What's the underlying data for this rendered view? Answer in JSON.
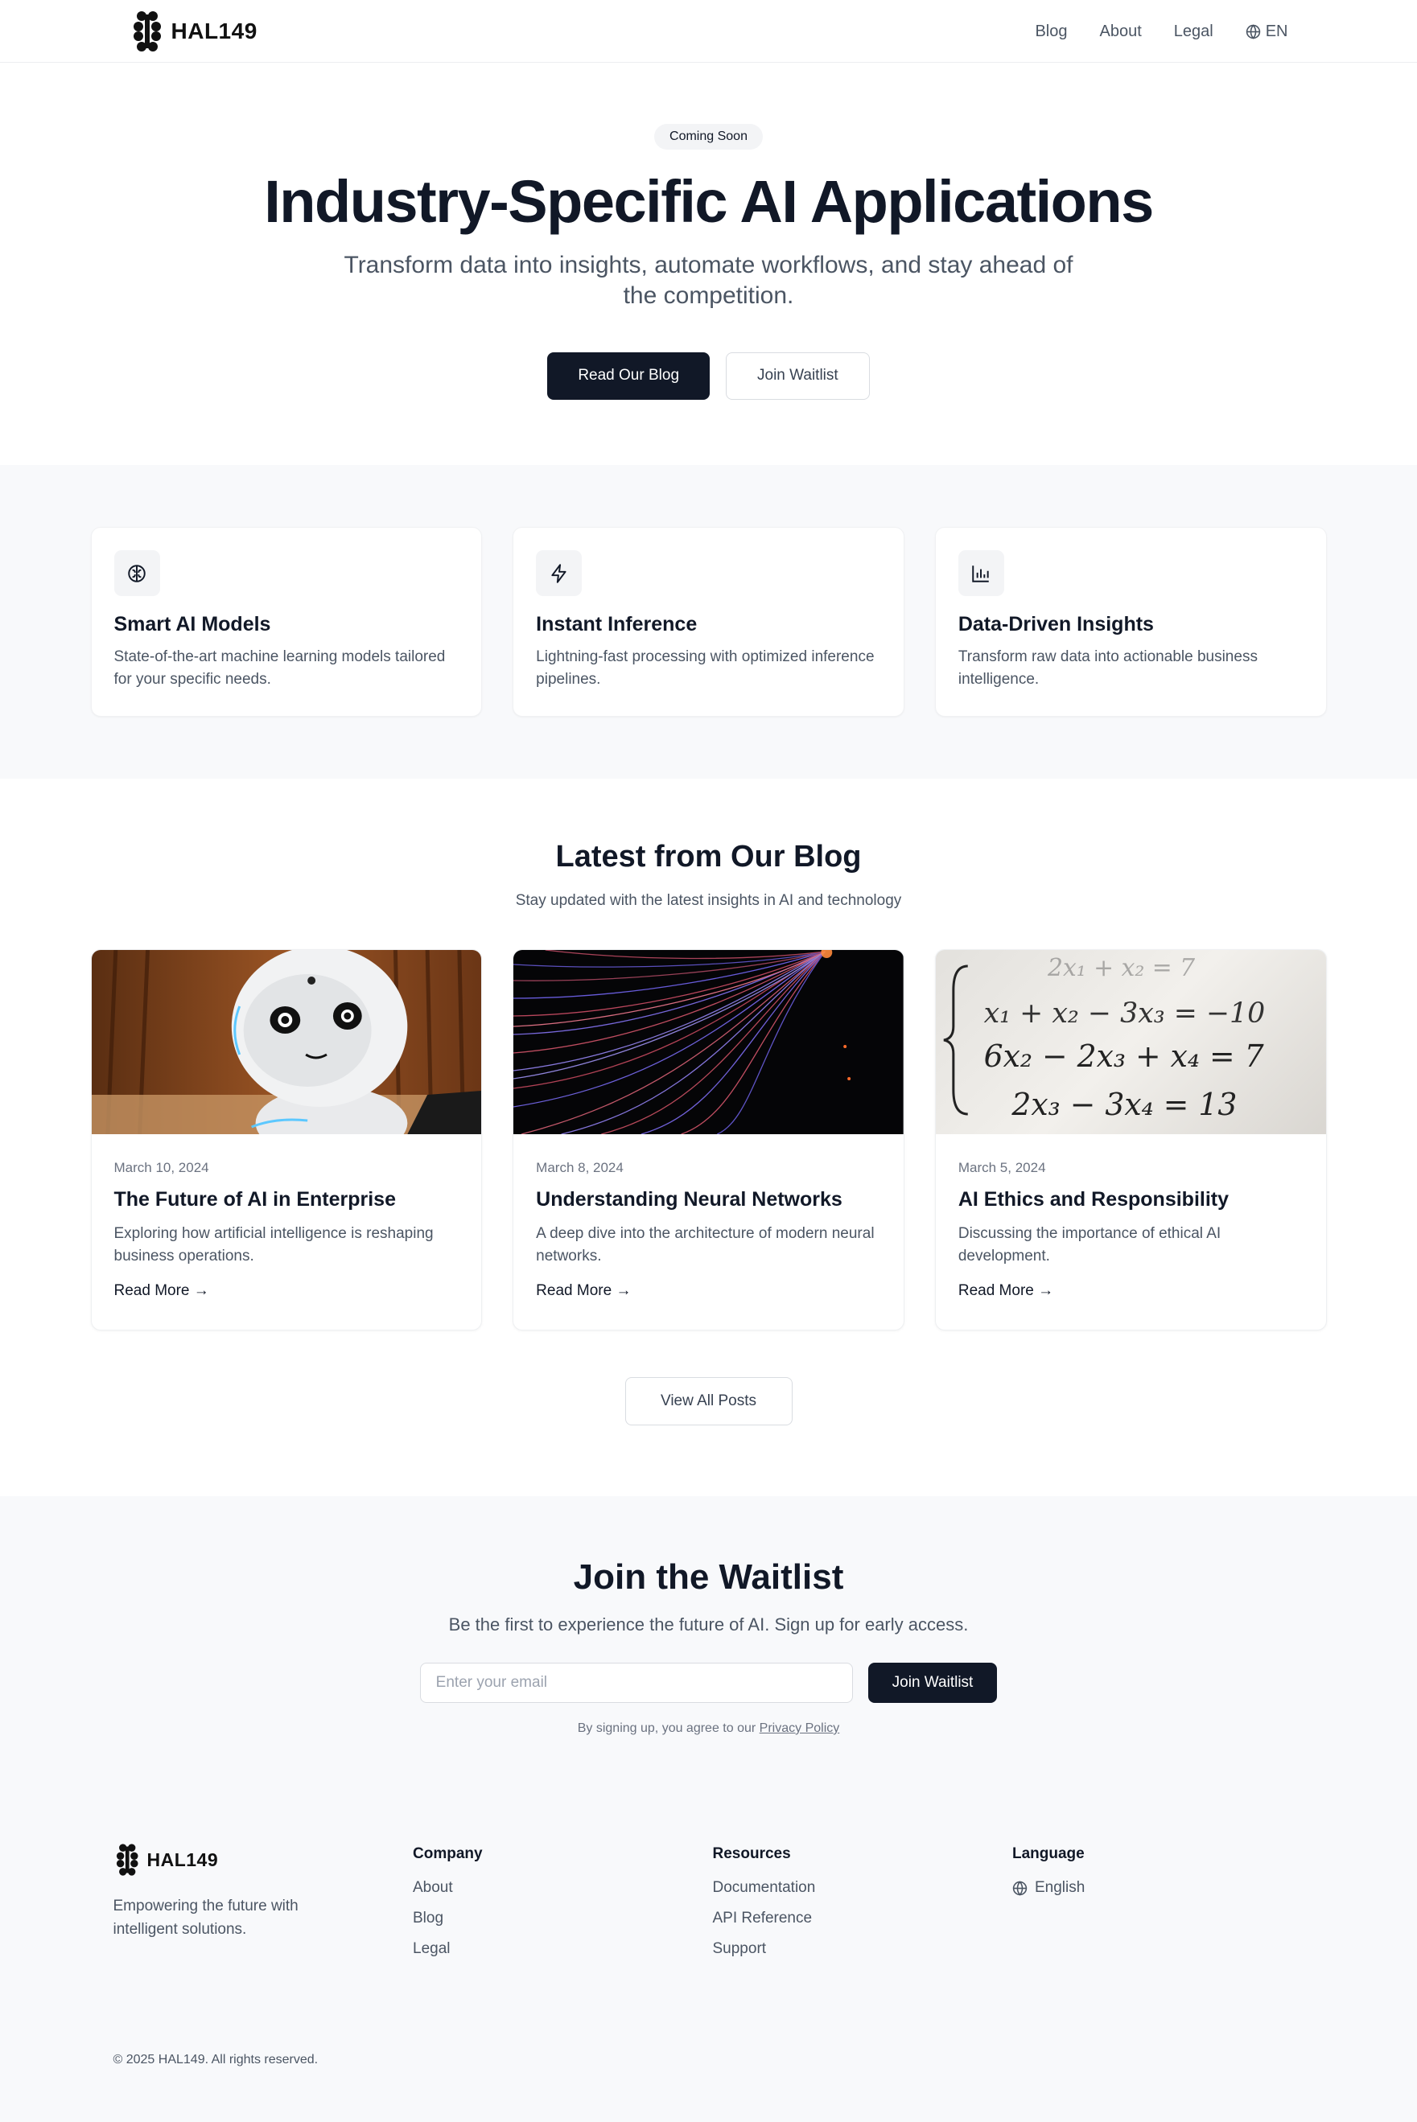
{
  "brand": {
    "name": "HAL149"
  },
  "nav": {
    "links": [
      "Blog",
      "About",
      "Legal"
    ],
    "lang_label": "EN"
  },
  "hero": {
    "badge": "Coming Soon",
    "title": "Industry-Specific AI Applications",
    "subtitle": "Transform data into insights, automate workflows, and stay ahead of the competition.",
    "primary_btn": "Read Our Blog",
    "secondary_btn": "Join Waitlist"
  },
  "features": [
    {
      "icon": "brain-icon",
      "title": "Smart AI Models",
      "desc": "State-of-the-art machine learning models tailored for your specific needs."
    },
    {
      "icon": "lightning-icon",
      "title": "Instant Inference",
      "desc": "Lightning-fast processing with optimized inference pipelines."
    },
    {
      "icon": "bar-chart-icon",
      "title": "Data-Driven Insights",
      "desc": "Transform raw data into actionable business intelligence."
    }
  ],
  "blog": {
    "title": "Latest from Our Blog",
    "subtitle": "Stay updated with the latest insights in AI and technology",
    "posts": [
      {
        "date": "March 10, 2024",
        "title": "The Future of AI in Enterprise",
        "excerpt": "Exploring how artificial intelligence is reshaping business operations.",
        "link": "Read More →"
      },
      {
        "date": "March 8, 2024",
        "title": "Understanding Neural Networks",
        "excerpt": "A deep dive into the architecture of modern neural networks.",
        "link": "Read More →"
      },
      {
        "date": "March 5, 2024",
        "title": "AI Ethics and Responsibility",
        "excerpt": "Discussing the importance of ethical AI development.",
        "link": "Read More →"
      }
    ],
    "view_all": "View All Posts"
  },
  "waitlist": {
    "title": "Join the Waitlist",
    "subtitle": "Be the first to experience the future of AI. Sign up for early access.",
    "email_placeholder": "Enter your email",
    "button": "Join Waitlist",
    "note_prefix": "By signing up, you agree to our",
    "note_link": "Privacy Policy"
  },
  "footer": {
    "tagline": "Empowering the future with intelligent solutions.",
    "company": {
      "heading": "Company",
      "links": [
        "About",
        "Blog",
        "Legal"
      ]
    },
    "resources": {
      "heading": "Resources",
      "links": [
        "Documentation",
        "API Reference",
        "Support"
      ]
    },
    "language": {
      "heading": "Language",
      "current": "English"
    },
    "copyright": "© 2025 HAL149. All rights reserved."
  },
  "colors": {
    "dark": "#111827",
    "muted": "#4b5563",
    "section_bg": "#f8f9fb"
  },
  "equation_lines": [
    "2x₁ + x₂ = 7",
    "x₁ + x₂ − 3x₃ = −10",
    "6x₂ − 2x₃ + x₄ = 7",
    "2x₃ − 3x₄ = 13"
  ]
}
